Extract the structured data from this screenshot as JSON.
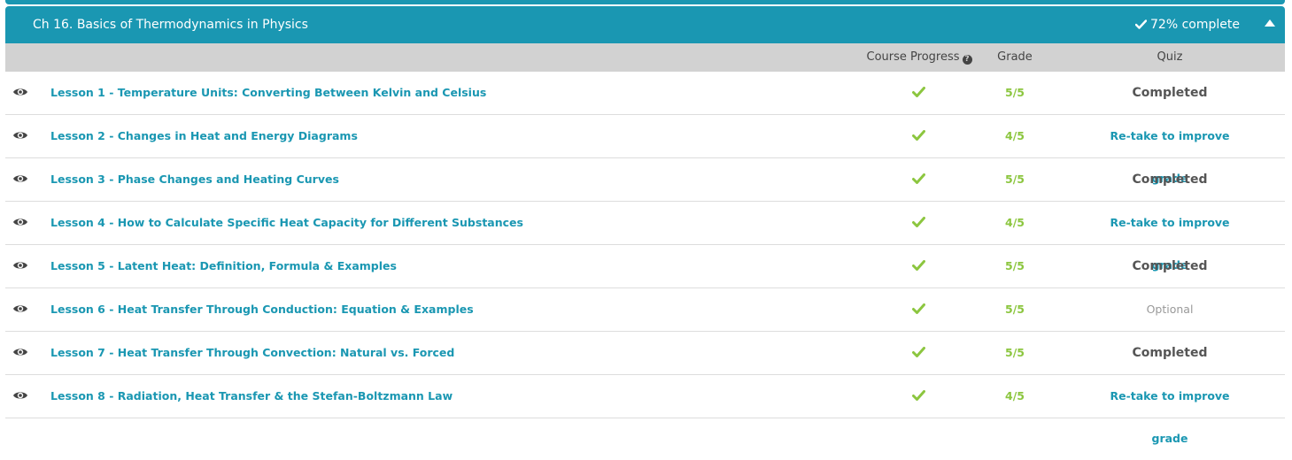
{
  "chapter": {
    "title": "Ch 16. Basics of Thermodynamics in Physics",
    "progress_text": "72% complete",
    "progress_value": 0.72
  },
  "columns": {
    "course_progress": "Course Progress",
    "grade": "Grade",
    "quiz": "Quiz"
  },
  "colors": {
    "accent": "#1a97b2",
    "success": "#8cc63f",
    "header_bg": "#d2d2d2"
  },
  "lessons": [
    {
      "title": "Lesson 1 - Temperature Units: Converting Between Kelvin and Celsius",
      "grade": "5/5",
      "quiz": "Completed",
      "quiz_type": "completed"
    },
    {
      "title": "Lesson 2 - Changes in Heat and Energy Diagrams",
      "grade": "4/5",
      "quiz": "Re-take to improve grade",
      "quiz_type": "retake"
    },
    {
      "title": "Lesson 3 - Phase Changes and Heating Curves",
      "grade": "5/5",
      "quiz": "Completed",
      "quiz_type": "completed"
    },
    {
      "title": "Lesson 4 - How to Calculate Specific Heat Capacity for Different Substances",
      "grade": "4/5",
      "quiz": "Re-take to improve grade",
      "quiz_type": "retake"
    },
    {
      "title": "Lesson 5 - Latent Heat: Definition, Formula & Examples",
      "grade": "5/5",
      "quiz": "Completed",
      "quiz_type": "completed"
    },
    {
      "title": "Lesson 6 - Heat Transfer Through Conduction: Equation & Examples",
      "grade": "5/5",
      "quiz": "Optional",
      "quiz_type": "optional"
    },
    {
      "title": "Lesson 7 - Heat Transfer Through Convection: Natural vs. Forced",
      "grade": "5/5",
      "quiz": "Completed",
      "quiz_type": "completed"
    },
    {
      "title": "Lesson 8 - Radiation, Heat Transfer & the Stefan-Boltzmann Law",
      "grade": "4/5",
      "quiz": "Re-take to improve grade",
      "quiz_type": "retake"
    }
  ]
}
